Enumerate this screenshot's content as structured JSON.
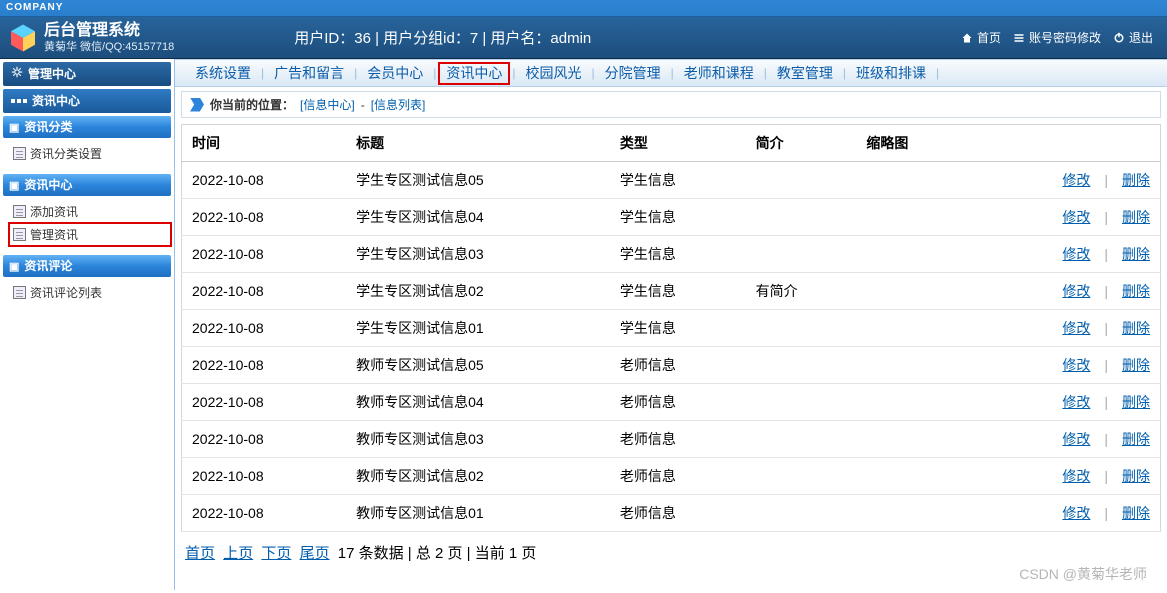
{
  "company_strip": "COMPANY",
  "header": {
    "title": "后台管理系统",
    "subtitle": "黄菊华 微信/QQ:45157718",
    "user_info": "用户ID：36 | 用户分组id：7 | 用户名：admin",
    "home": "首页",
    "account_edit": "账号密码修改",
    "logout": "退出"
  },
  "left": {
    "panel_title": "管理中心",
    "section_title": "资讯中心",
    "groups": [
      {
        "name": "资讯分类",
        "items": [
          {
            "label": "资讯分类设置",
            "active": false
          }
        ]
      },
      {
        "name": "资讯中心",
        "items": [
          {
            "label": "添加资讯",
            "active": false
          },
          {
            "label": "管理资讯",
            "active": true
          }
        ]
      },
      {
        "name": "资讯评论",
        "items": [
          {
            "label": "资讯评论列表",
            "active": false
          }
        ]
      }
    ]
  },
  "topnav": [
    {
      "label": "系统设置",
      "active": false
    },
    {
      "label": "广告和留言",
      "active": false
    },
    {
      "label": "会员中心",
      "active": false
    },
    {
      "label": "资讯中心",
      "active": true
    },
    {
      "label": "校园风光",
      "active": false
    },
    {
      "label": "分院管理",
      "active": false
    },
    {
      "label": "老师和课程",
      "active": false
    },
    {
      "label": "教室管理",
      "active": false
    },
    {
      "label": "班级和排课",
      "active": false
    }
  ],
  "breadcrumb": {
    "label": "你当前的位置：",
    "p1": "[信息中心]",
    "sep": "-",
    "p2": "[信息列表]"
  },
  "table": {
    "cols": [
      "时间",
      "标题",
      "类型",
      "简介",
      "缩略图"
    ],
    "edit": "修改",
    "del": "删除",
    "rows": [
      {
        "date": "2022-10-08",
        "title": "学生专区测试信息05",
        "type": "学生信息",
        "intro": "",
        "thumb": ""
      },
      {
        "date": "2022-10-08",
        "title": "学生专区测试信息04",
        "type": "学生信息",
        "intro": "",
        "thumb": ""
      },
      {
        "date": "2022-10-08",
        "title": "学生专区测试信息03",
        "type": "学生信息",
        "intro": "",
        "thumb": ""
      },
      {
        "date": "2022-10-08",
        "title": "学生专区测试信息02",
        "type": "学生信息",
        "intro": "有简介",
        "thumb": ""
      },
      {
        "date": "2022-10-08",
        "title": "学生专区测试信息01",
        "type": "学生信息",
        "intro": "",
        "thumb": ""
      },
      {
        "date": "2022-10-08",
        "title": "教师专区测试信息05",
        "type": "老师信息",
        "intro": "",
        "thumb": ""
      },
      {
        "date": "2022-10-08",
        "title": "教师专区测试信息04",
        "type": "老师信息",
        "intro": "",
        "thumb": ""
      },
      {
        "date": "2022-10-08",
        "title": "教师专区测试信息03",
        "type": "老师信息",
        "intro": "",
        "thumb": ""
      },
      {
        "date": "2022-10-08",
        "title": "教师专区测试信息02",
        "type": "老师信息",
        "intro": "",
        "thumb": ""
      },
      {
        "date": "2022-10-08",
        "title": "教师专区测试信息01",
        "type": "老师信息",
        "intro": "",
        "thumb": ""
      }
    ]
  },
  "pager": {
    "first": "首页",
    "prev": "上页",
    "next": "下页",
    "last": "尾页",
    "info": "17 条数据 | 总 2 页 | 当前 1 页"
  },
  "watermark": "CSDN @黄菊华老师"
}
